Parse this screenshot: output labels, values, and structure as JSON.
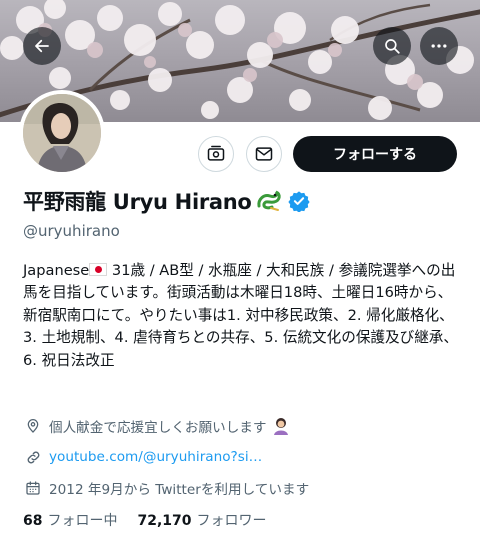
{
  "header": {
    "back_icon": "arrow-left-icon",
    "search_icon": "search-icon",
    "more_icon": "more-horizontal-icon"
  },
  "actions": {
    "follow_label": "フォローする",
    "subscribe_icon": "notification-subscribe-icon",
    "message_icon": "envelope-icon"
  },
  "profile": {
    "name": "平野雨龍 Uryu Hirano",
    "handle": "@uryuhirano",
    "bio": [
      "Japanese",
      " 31歳 / AB型 / 水瓶座 / 大和民族 / 参議院選挙への出馬を目指しています。街頭活動は木曜日18時、土曜日16時から、新宿駅南口にて。やりたい事は1. 対中移民政策、2. 帰化厳格化、3. 土地規制、4. 虐待育ちとの共存、5. 伝統文化の保護及び継承、6. 祝日法改正"
    ],
    "location": "個人献金で応援宜しくお願いします",
    "link": "youtube.com/@uryuhirano?si…",
    "joined": "2012 年9月から Twitterを利用しています"
  },
  "stats": {
    "following_count": "68",
    "following_label": "フォロー中",
    "followers_count": "72,170",
    "followers_label": "フォロワー"
  },
  "colors": {
    "accent": "#1d9bf0",
    "text": "#0f1419",
    "muted": "#536471",
    "button": "#0f1419"
  }
}
